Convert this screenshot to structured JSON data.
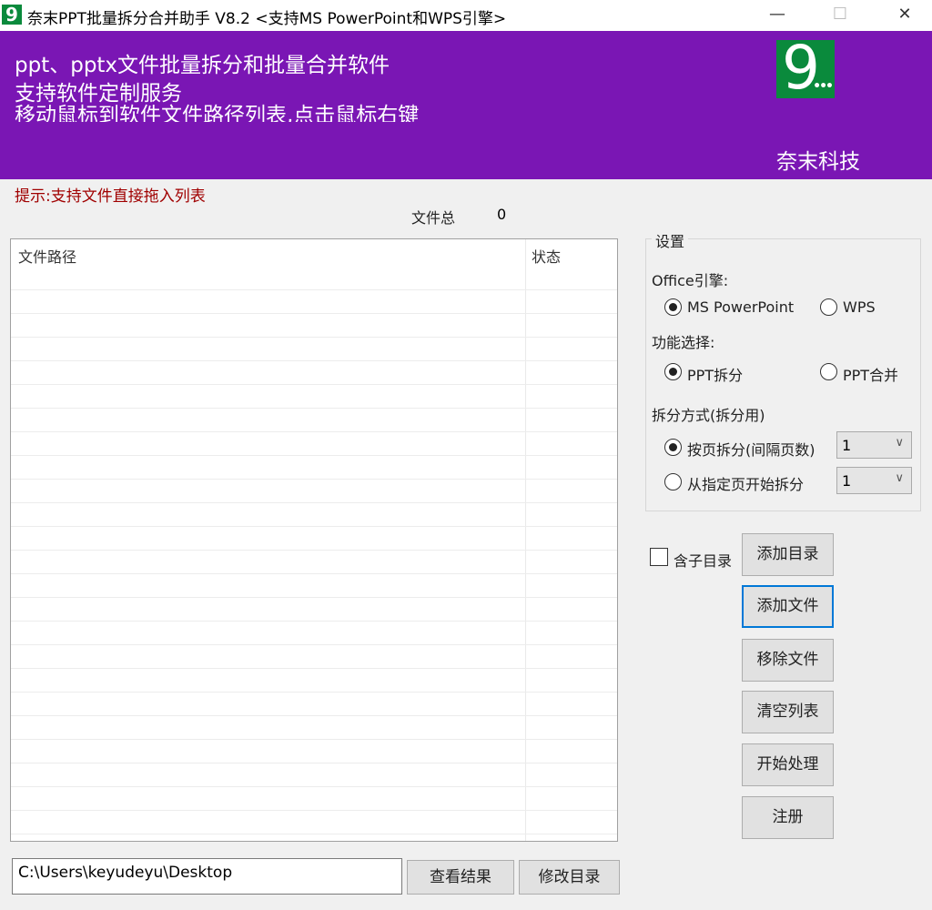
{
  "window": {
    "title": "奈末PPT批量拆分合并助手 V8.2  <支持MS PowerPoint和WPS引擎>",
    "icon": "app-logo-icon",
    "minimize": "—",
    "maximize": "☐",
    "close": "✕"
  },
  "banner": {
    "lines": [
      "ppt、pptx文件批量拆分和批量合并软件",
      "支持软件定制服务",
      "移动鼠标到软件文件路径列表,点击鼠标右键"
    ],
    "company": "奈末科技",
    "logo_text": "9...",
    "color": "#7a16b4",
    "logo_color": "#0a8a3c"
  },
  "hint": "提示:支持文件直接拖入列表",
  "file_total": {
    "label": "文件总",
    "value": "0"
  },
  "file_list": {
    "columns": [
      "文件路径",
      "状态"
    ],
    "rows": []
  },
  "settings": {
    "title": "设置",
    "engine_label": "Office引擎:",
    "engine_options": [
      {
        "label": "MS PowerPoint",
        "selected": true
      },
      {
        "label": "WPS",
        "selected": false
      }
    ],
    "function_label": "功能选择:",
    "function_options": [
      {
        "label": "PPT拆分",
        "selected": true
      },
      {
        "label": "PPT合并",
        "selected": false
      }
    ],
    "split_label": "拆分方式(拆分用)",
    "split_options": [
      {
        "label": "按页拆分(间隔页数)",
        "selected": true,
        "value": "1"
      },
      {
        "label": "从指定页开始拆分",
        "selected": false,
        "value": "1"
      }
    ]
  },
  "include_subdir": {
    "label": "含子目录",
    "checked": false
  },
  "buttons": {
    "add_dir": "添加目录",
    "add_file": "添加文件",
    "remove_file": "移除文件",
    "clear_list": "清空列表",
    "start": "开始处理",
    "register": "注册",
    "view_result": "查看结果",
    "change_dir": "修改目录"
  },
  "output_path": "C:\\Users\\keyudeyu\\Desktop"
}
